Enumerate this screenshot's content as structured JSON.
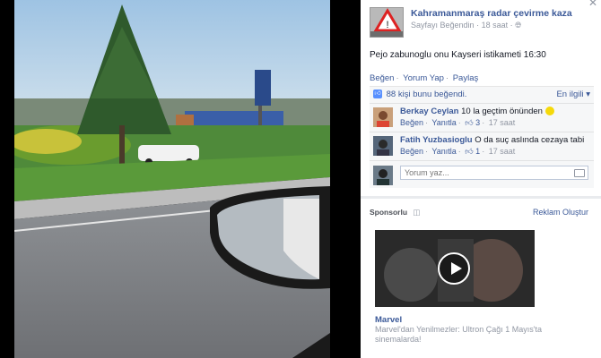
{
  "post": {
    "page_name": "Kahramanmaraş radar çevirme kaza",
    "liked_label": "Sayfayı Beğendin",
    "time": "18 saat",
    "text": "Pejo zabunoglu onu Kayseri istikameti 16:30",
    "actions": [
      "Beğen",
      "Yorum Yap",
      "Paylaş"
    ]
  },
  "likes": {
    "count_text": "88 kişi bunu beğendi.",
    "recent_label": "En ilgili"
  },
  "comments": [
    {
      "author": "Berkay Ceylan",
      "text": "10 la geçtim önünden",
      "like": "Beğen",
      "reply": "Yanıtla",
      "likes": "3",
      "time": "17 saat"
    },
    {
      "author": "Fatih Yuzbasioglu",
      "text": "O da suç aslında cezaya tabi",
      "like": "Beğen",
      "reply": "Yanıtla",
      "likes": "1",
      "time": "17 saat"
    }
  ],
  "comment_box": {
    "placeholder": "Yorum yaz..."
  },
  "sponsored": {
    "label": "Sponsorlu",
    "create_ad": "Reklam Oluştur",
    "ad_title": "Marvel",
    "ad_desc": "Marvel'dan Yenilmezler: Ultron Çağı 1 Mayıs'ta sinemalarda!"
  },
  "colors": {
    "link": "#3b5998",
    "muted": "#9197a3",
    "like_blue": "#5890ff"
  }
}
